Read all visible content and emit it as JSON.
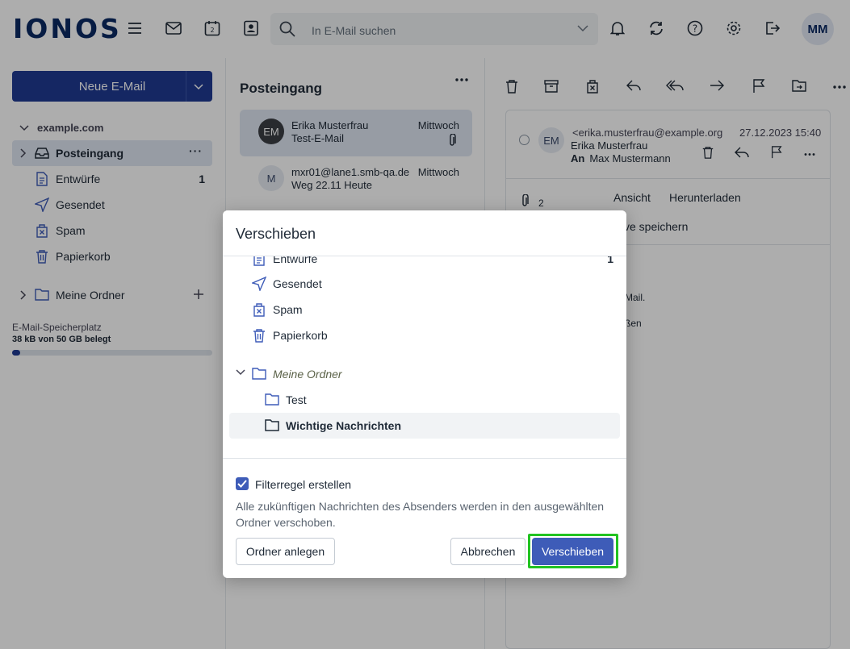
{
  "app": {
    "logo": "IONOS"
  },
  "search": {
    "placeholder": "In E-Mail suchen"
  },
  "user": {
    "initials": "MM"
  },
  "sidebar": {
    "new_mail": "Neue E-Mail",
    "account": "example.com",
    "folders": [
      {
        "label": "Posteingang",
        "icon": "inbox-icon",
        "count": ""
      },
      {
        "label": "Entwürfe",
        "icon": "draft-icon",
        "count": "1"
      },
      {
        "label": "Gesendet",
        "icon": "send-icon",
        "count": ""
      },
      {
        "label": "Spam",
        "icon": "spam-icon",
        "count": ""
      },
      {
        "label": "Papierkorb",
        "icon": "trash-icon",
        "count": ""
      }
    ],
    "my_folders": "Meine Ordner",
    "storage_label": "E-Mail-Speicherplatz",
    "storage_value": "38 kB von 50 GB belegt",
    "storage_used_fraction": 0.04
  },
  "list": {
    "title": "Posteingang",
    "mails": [
      {
        "initials": "EM",
        "from": "Erika Musterfrau",
        "subject": "Test-E-Mail",
        "date": "Mittwoch"
      },
      {
        "initials": "M",
        "from": "mxr01@lane1.smb-qa.de",
        "subject": "Weg 22.11 Heute",
        "date": "Mittwoch"
      }
    ]
  },
  "reader": {
    "initials": "EM",
    "email": "<erika.musterfrau@example.org>",
    "date": "27.12.2023 15:40",
    "sender": "Erika Musterfrau",
    "to_label": "An",
    "to": "Max Mustermann",
    "attachment_count": "2",
    "view": "Ansicht",
    "download": "Herunterladen",
    "save_archive_partial": "ve speichern",
    "body_partial_1": "Mail.",
    "body_partial_2": "ßen"
  },
  "modal": {
    "title": "Verschieben",
    "folders": [
      {
        "label": "Entwürfe",
        "count": "1"
      },
      {
        "label": "Gesendet"
      },
      {
        "label": "Spam"
      },
      {
        "label": "Papierkorb"
      },
      {
        "label": "Meine Ordner"
      },
      {
        "label": "Test"
      },
      {
        "label": "Wichtige Nachrichten"
      }
    ],
    "checkbox_label": "Filterregel erstellen",
    "checkbox_checked": true,
    "hint": "Alle zukünftigen Nachrichten des Absenders werden in den ausgewählten Ordner verschoben.",
    "create_folder": "Ordner anlegen",
    "cancel": "Abbrechen",
    "confirm": "Verschieben"
  }
}
